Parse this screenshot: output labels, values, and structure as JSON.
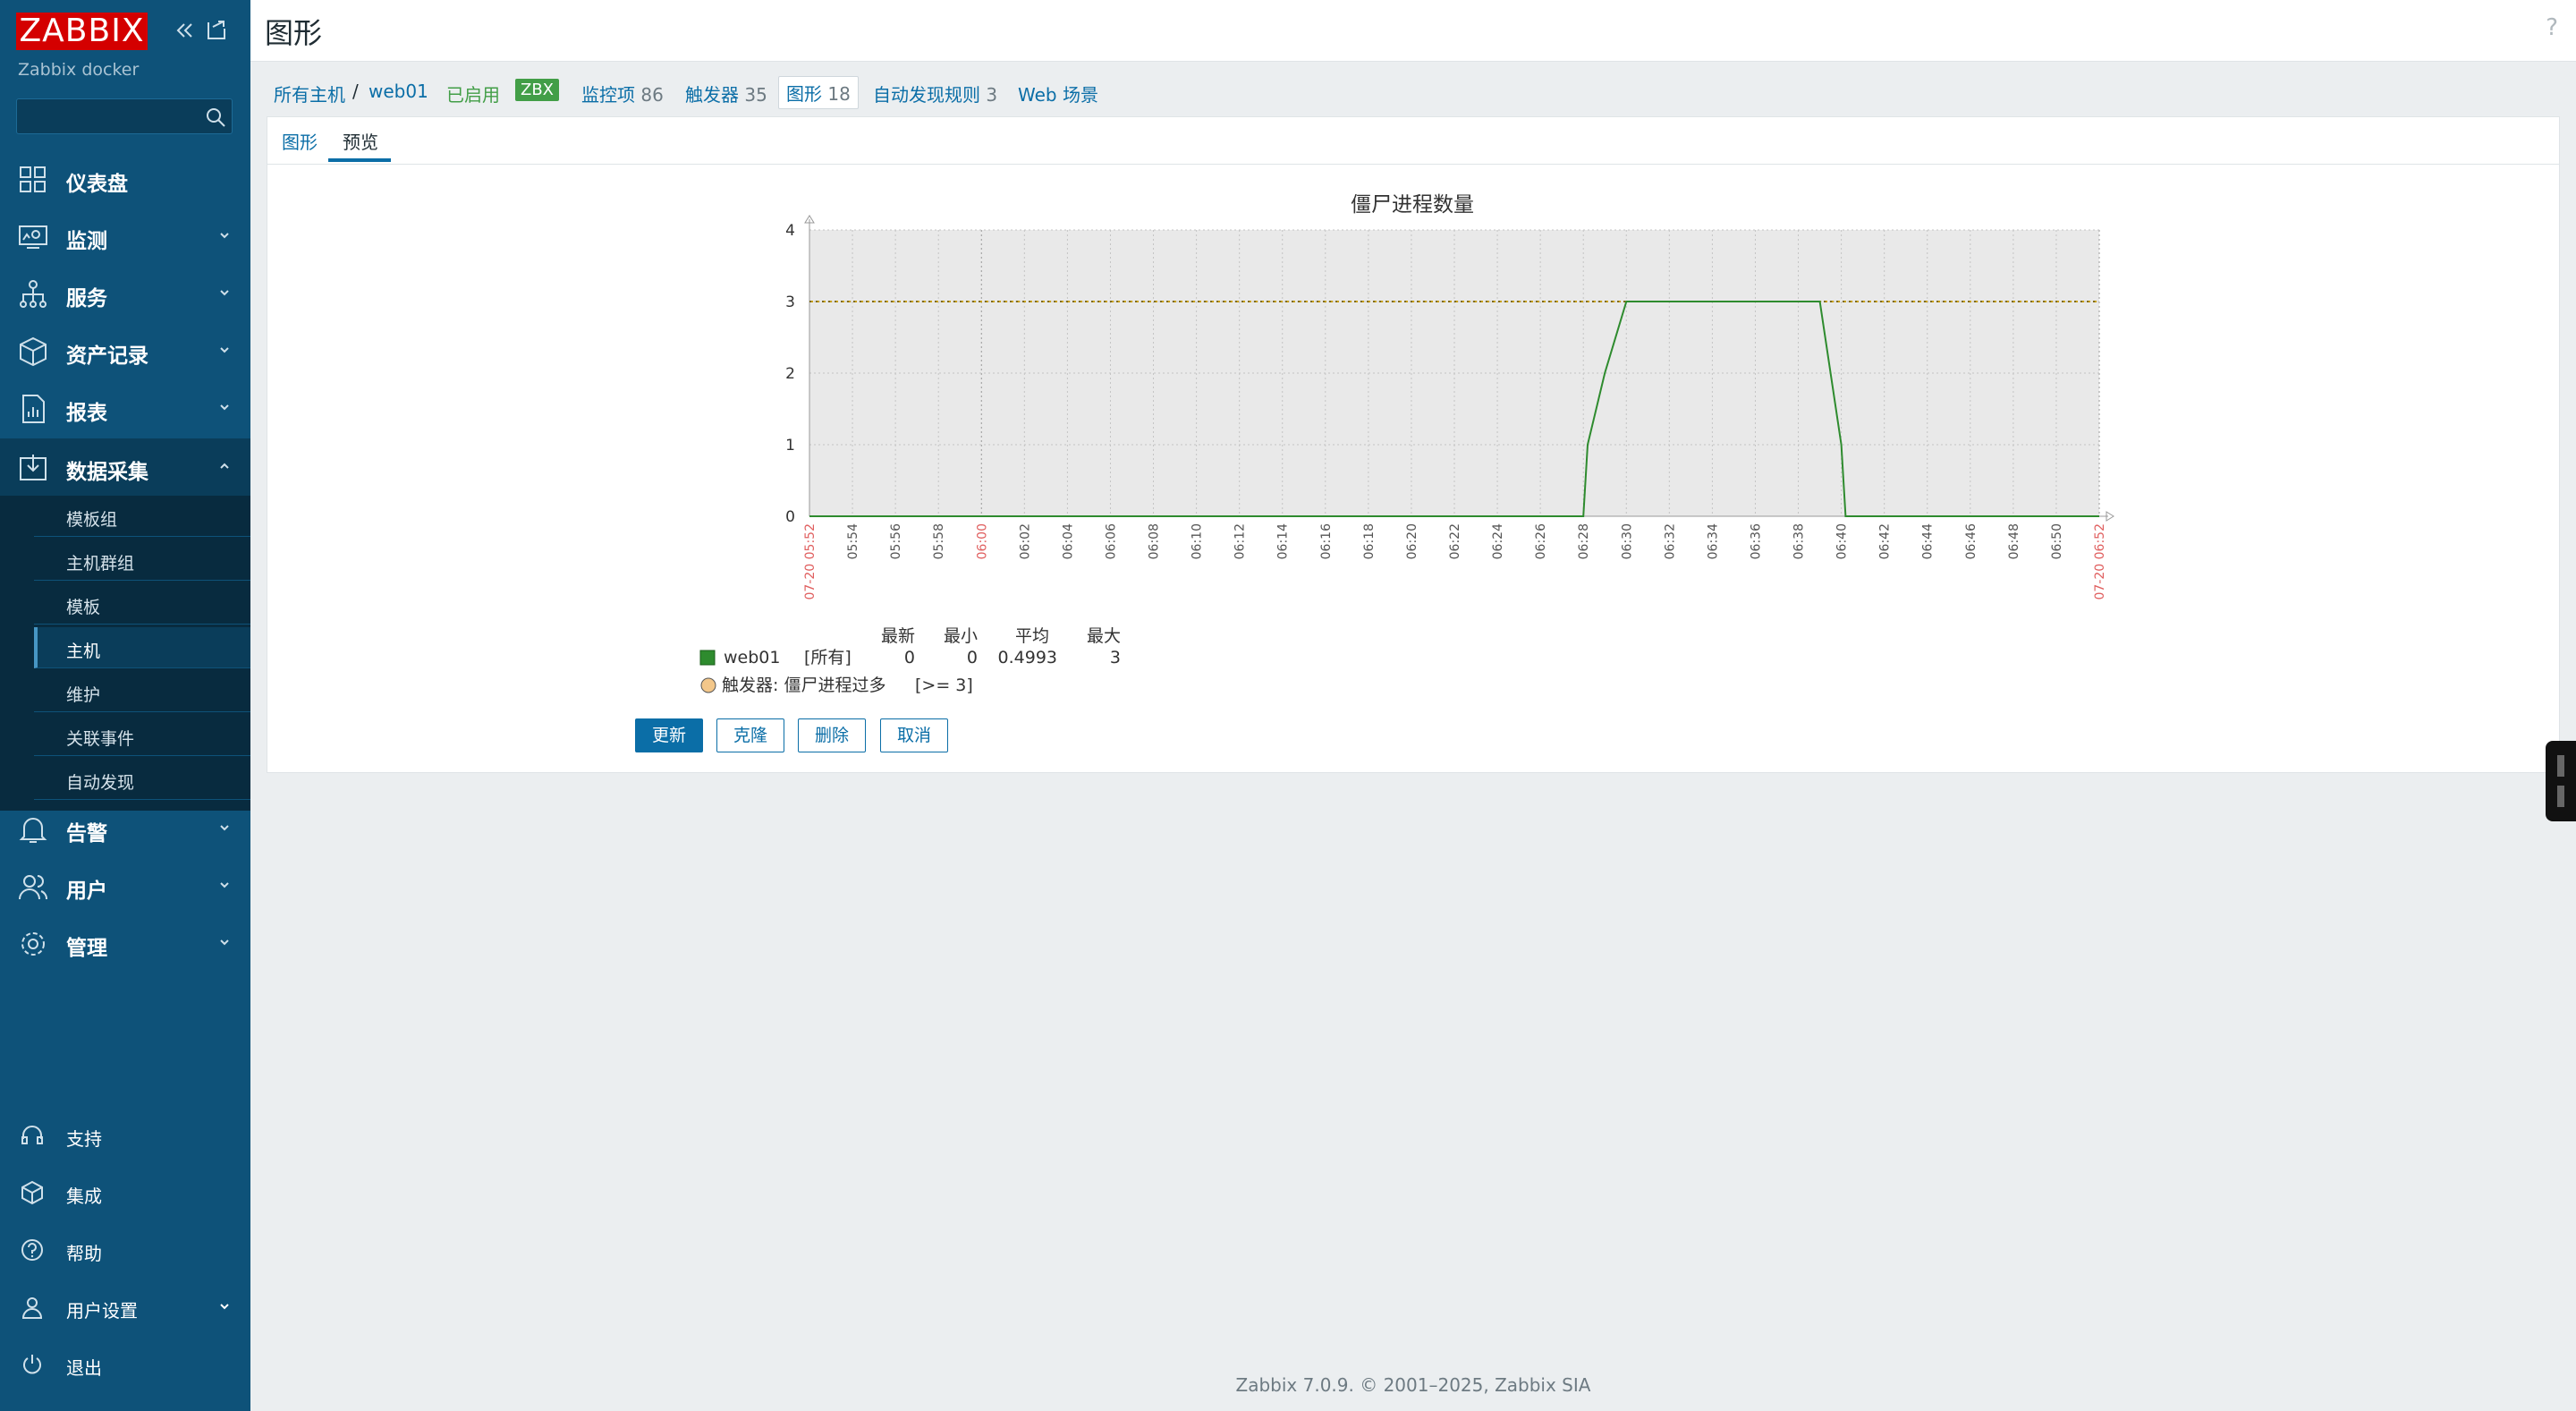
{
  "sidebar": {
    "logo": "ZABBIX",
    "server_name": "Zabbix docker",
    "search_placeholder": "",
    "menu": [
      {
        "label": "仪表盘",
        "icon": "dashboard-icon"
      },
      {
        "label": "监测",
        "icon": "monitoring-icon"
      },
      {
        "label": "服务",
        "icon": "services-icon"
      },
      {
        "label": "资产记录",
        "icon": "inventory-icon"
      },
      {
        "label": "报表",
        "icon": "reports-icon"
      },
      {
        "label": "数据采集",
        "icon": "data-collection-icon"
      }
    ],
    "submenu": [
      "模板组",
      "主机群组",
      "模板",
      "主机",
      "维护",
      "关联事件",
      "自动发现"
    ],
    "menu2": [
      {
        "label": "告警",
        "icon": "bell-icon"
      },
      {
        "label": "用户",
        "icon": "users-icon"
      },
      {
        "label": "管理",
        "icon": "gear-icon"
      }
    ],
    "bottom": [
      {
        "label": "支持",
        "icon": "headset-icon"
      },
      {
        "label": "集成",
        "icon": "integrations-icon"
      },
      {
        "label": "帮助",
        "icon": "help-icon"
      },
      {
        "label": "用户设置",
        "icon": "user-settings-icon"
      },
      {
        "label": "退出",
        "icon": "power-icon"
      }
    ]
  },
  "header": {
    "title": "图形",
    "help": "?"
  },
  "hostnav": {
    "all_hosts": "所有主机",
    "separator": "/",
    "host": "web01",
    "status": "已启用",
    "badge": "ZBX",
    "items_label": "监控项",
    "items_count": "86",
    "triggers_label": "触发器",
    "triggers_count": "35",
    "graphs_label": "图形",
    "graphs_count": "18",
    "discovery_label": "自动发现规则",
    "discovery_count": "3",
    "web_label": "Web 场景"
  },
  "tabs": {
    "graph": "图形",
    "preview": "预览"
  },
  "legend": {
    "headers": [
      "最新",
      "最小",
      "平均",
      "最大"
    ],
    "item_name": "web01",
    "item_func": "[所有]",
    "item_values": [
      "0",
      "0",
      "0.4993",
      "3"
    ],
    "trigger_text": "触发器: 僵尸进程过多",
    "trigger_cond": "[>= 3]"
  },
  "buttons": {
    "update": "更新",
    "clone": "克隆",
    "delete": "删除",
    "cancel": "取消"
  },
  "footer": "Zabbix 7.0.9. © 2001–2025, Zabbix SIA",
  "colors": {
    "series": "#2e8b2e",
    "trigger": "#c8a000",
    "accent": "#0b6ea7",
    "sidebar": "#0e5279",
    "brand": "#d40000"
  },
  "chart_data": {
    "type": "line",
    "title": "僵尸进程数量",
    "ylim": [
      0,
      4
    ],
    "yticks": [
      0,
      1,
      2,
      3,
      4
    ],
    "xlabels": [
      "07-20 05:52",
      "05:54",
      "05:56",
      "05:58",
      "06:00",
      "06:02",
      "06:04",
      "06:06",
      "06:08",
      "06:10",
      "06:12",
      "06:14",
      "06:16",
      "06:18",
      "06:20",
      "06:22",
      "06:24",
      "06:26",
      "06:28",
      "06:30",
      "06:32",
      "06:34",
      "06:36",
      "06:38",
      "06:40",
      "06:42",
      "06:44",
      "06:46",
      "06:48",
      "06:50",
      "07-20 06:52"
    ],
    "red_labels": [
      0,
      4,
      30
    ],
    "series": [
      {
        "name": "web01",
        "x": [
          "05:52",
          "06:13",
          "06:14",
          "06:28",
          "06:28",
          "06:29",
          "06:30",
          "06:39",
          "06:40",
          "06:40",
          "06:52"
        ],
        "y": [
          0,
          0,
          0,
          0,
          1,
          2,
          3,
          3,
          1,
          0,
          0
        ]
      }
    ],
    "trigger_level": 3,
    "grid": true
  }
}
